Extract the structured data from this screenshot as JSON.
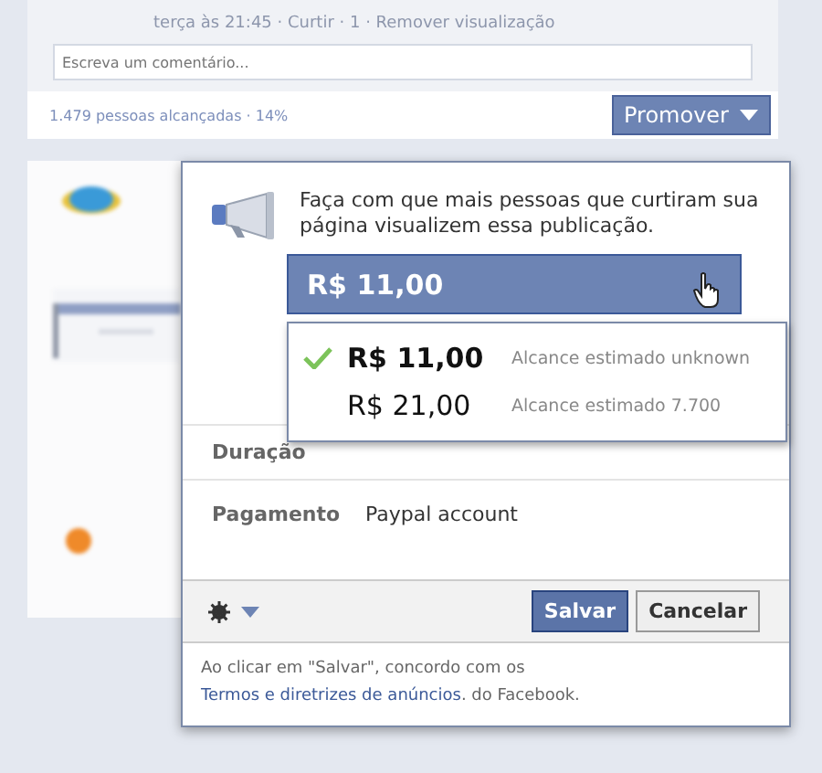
{
  "background_post": {
    "meta": "terça às 21:45 · Curtir · 1 · Remover visualização",
    "comment_placeholder": "Escreva um comentário...",
    "reach": "1.479 pessoas alcançadas · 14%"
  },
  "promote_button": {
    "label": "Promover"
  },
  "promote_dialog": {
    "description": "Faça com que mais pessoas que curtiram sua página visualizem essa publicação.",
    "budget_select": {
      "value": "R$ 11,00",
      "expanded": true
    },
    "budget_options": [
      {
        "amount": "R$ 11,00",
        "estimate": "Alcance estimado unknown",
        "selected": true
      },
      {
        "amount": "R$ 21,00",
        "estimate": "Alcance estimado 7.700",
        "selected": false
      }
    ],
    "fields": [
      {
        "label": "Duração"
      },
      {
        "label": "Pagamento",
        "value": "Paypal account"
      }
    ],
    "buttons": [
      {
        "label": "Salvar",
        "kind": "primary"
      },
      {
        "label": "Cancelar",
        "kind": "secondary"
      }
    ],
    "terms": {
      "before": "Ao clicar em \"Salvar\", concordo com os ",
      "link": "Termos e diretrizes de anúncios",
      "after": ". do Facebook."
    }
  }
}
